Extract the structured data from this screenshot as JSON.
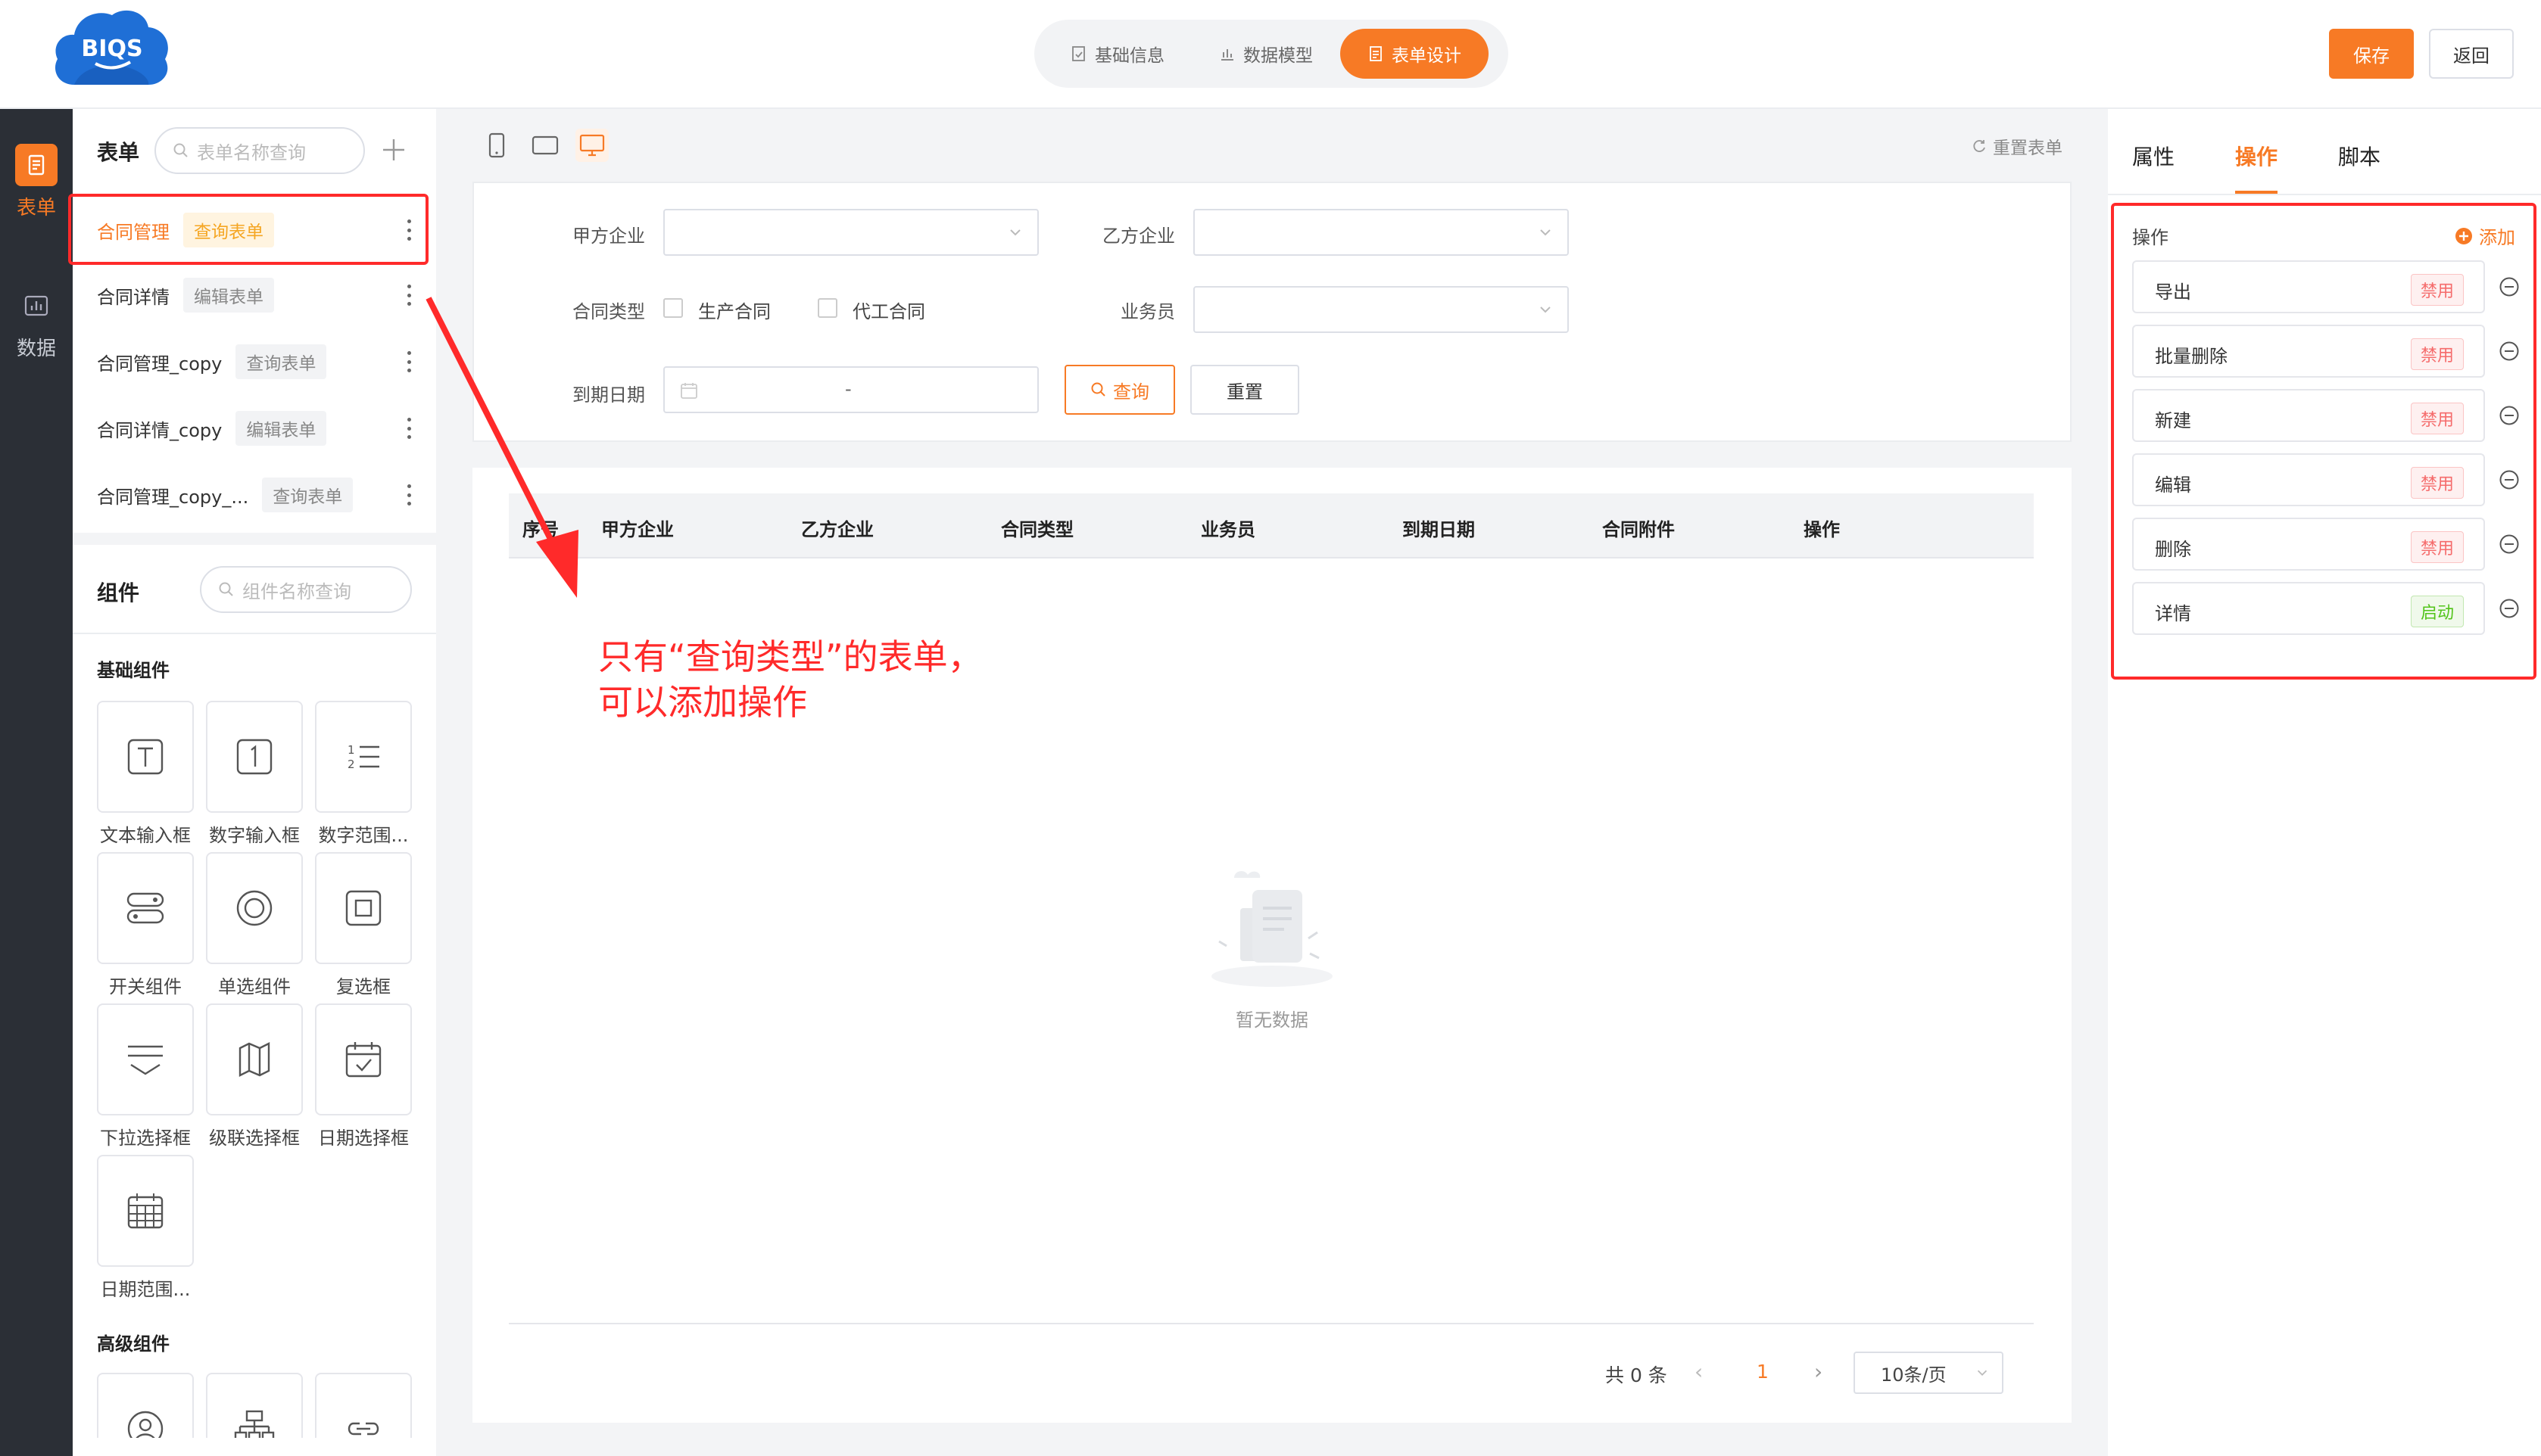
{
  "brand": {
    "logo_text": "BIQS",
    "accent": "#f77a25",
    "annotation_color": "#ff2a2a"
  },
  "steps": [
    {
      "label": "基础信息",
      "icon": "form-check-icon",
      "active": false
    },
    {
      "label": "数据模型",
      "icon": "bar-chart-icon",
      "active": false
    },
    {
      "label": "表单设计",
      "icon": "form-icon",
      "active": true
    }
  ],
  "header": {
    "save_label": "保存",
    "back_label": "返回"
  },
  "rail": {
    "items": [
      {
        "label": "表单",
        "active": true
      },
      {
        "label": "数据",
        "active": false
      }
    ]
  },
  "forms": {
    "title": "表单",
    "search_placeholder": "表单名称查询",
    "items": [
      {
        "name": "合同管理",
        "tag": "查询表单",
        "active": true
      },
      {
        "name": "合同详情",
        "tag": "编辑表单"
      },
      {
        "name": "合同管理_copy",
        "tag": "查询表单"
      },
      {
        "name": "合同详情_copy",
        "tag": "编辑表单"
      },
      {
        "name": "合同管理_copy_...",
        "tag": "查询表单"
      }
    ]
  },
  "components": {
    "title": "组件",
    "search_placeholder": "组件名称查询",
    "basic_title": "基础组件",
    "basic": [
      {
        "label": "文本输入框",
        "icon": "text-input-icon"
      },
      {
        "label": "数字输入框",
        "icon": "number-input-icon"
      },
      {
        "label": "数字范围...",
        "icon": "number-range-icon"
      },
      {
        "label": "开关组件",
        "icon": "switch-icon"
      },
      {
        "label": "单选组件",
        "icon": "radio-icon"
      },
      {
        "label": "复选框",
        "icon": "checkbox-icon"
      },
      {
        "label": "下拉选择框",
        "icon": "dropdown-icon"
      },
      {
        "label": "级联选择框",
        "icon": "cascader-icon"
      },
      {
        "label": "日期选择框",
        "icon": "date-picker-icon"
      },
      {
        "label": "日期范围...",
        "icon": "date-range-icon"
      }
    ],
    "advanced_title": "高级组件",
    "advanced_icons": [
      "user-icon",
      "org-tree-icon",
      "link-icon"
    ]
  },
  "canvas": {
    "reset_form_label": "重置表单",
    "filters": {
      "party_a_label": "甲方企业",
      "party_b_label": "乙方企业",
      "contract_type_label": "合同类型",
      "contract_type_options": [
        "生产合同",
        "代工合同"
      ],
      "salesperson_label": "业务员",
      "due_date_label": "到期日期",
      "date_separator": "-",
      "query_label": "查询",
      "reset_label": "重置"
    },
    "table": {
      "columns": [
        "序号",
        "甲方企业",
        "乙方企业",
        "合同类型",
        "业务员",
        "到期日期",
        "合同附件",
        "操作"
      ],
      "empty_text": "暂无数据"
    },
    "pager": {
      "total": "共 0 条",
      "page": "1",
      "page_size": "10条/页"
    }
  },
  "annotation": {
    "line1": "只有“查询类型”的表单，",
    "line2": "可以添加操作"
  },
  "right_panel": {
    "tabs": [
      {
        "label": "属性"
      },
      {
        "label": "操作",
        "active": true
      },
      {
        "label": "脚本"
      }
    ],
    "ops_label": "操作",
    "add_label": "添加",
    "operations": [
      {
        "name": "导出",
        "status": "禁用",
        "enabled": false
      },
      {
        "name": "批量删除",
        "status": "禁用",
        "enabled": false
      },
      {
        "name": "新建",
        "status": "禁用",
        "enabled": false
      },
      {
        "name": "编辑",
        "status": "禁用",
        "enabled": false
      },
      {
        "name": "删除",
        "status": "禁用",
        "enabled": false
      },
      {
        "name": "详情",
        "status": "启动",
        "enabled": true
      }
    ]
  }
}
